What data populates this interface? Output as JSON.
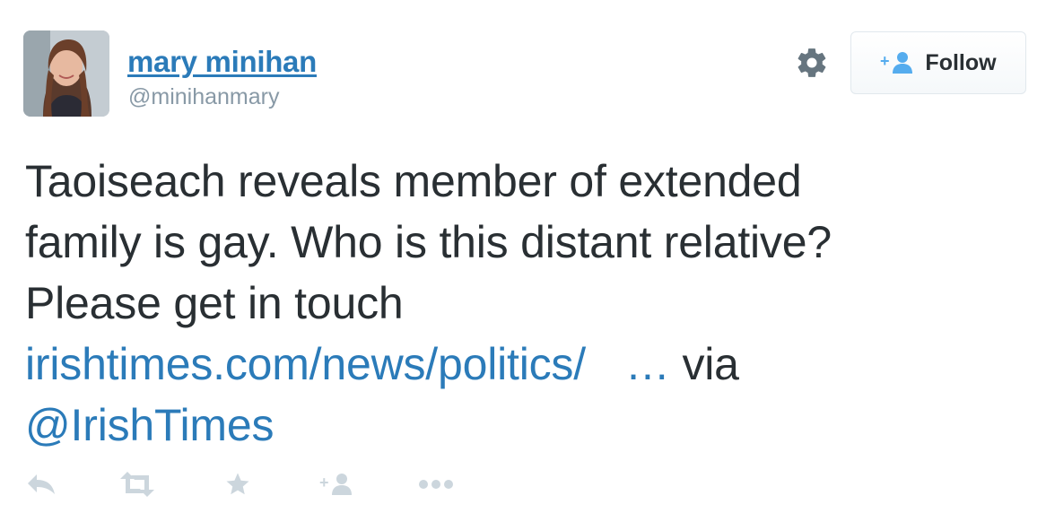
{
  "author": {
    "display_name": "mary minihan",
    "handle": "@minihanmary"
  },
  "follow_button": {
    "label": "Follow"
  },
  "tweet": {
    "line1": "Taoiseach reveals member of extended",
    "line2": "family is gay. Who is this distant relative?",
    "line3": "Please get in touch",
    "link_text": "irishtimes.com/news/politics/",
    "link_ellipsis": "…",
    "via_text": "via",
    "mention": "@IrishTimes"
  },
  "icons": {
    "settings": "gear-icon",
    "follow": "add-user-icon",
    "reply": "reply-icon",
    "retweet": "retweet-icon",
    "favorite": "star-icon",
    "follow_action": "add-user-icon",
    "more": "more-icon"
  },
  "colors": {
    "link": "#2b7bb9",
    "text": "#292f33",
    "muted": "#8899a6",
    "action_icon": "#ccd6dd"
  }
}
